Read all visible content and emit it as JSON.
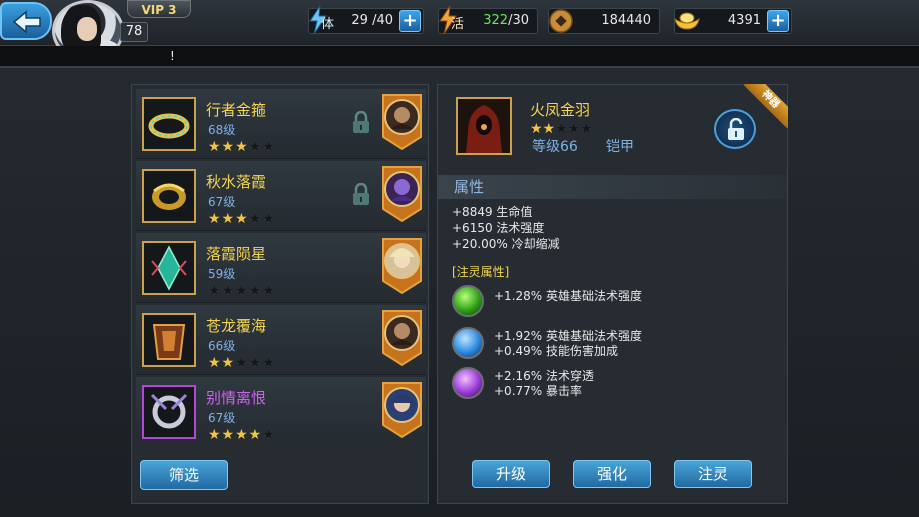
{
  "header": {
    "vip_label": "VIP 3",
    "player_level": "78",
    "stamina_label": "体",
    "stamina_value": "29",
    "stamina_max": "/40",
    "vitality_label": "活",
    "vitality_value": "322",
    "vitality_max": "/30",
    "coins": "184440",
    "ingots": "4391"
  },
  "notice": "!",
  "equipment_list": [
    {
      "name": "行者金箍",
      "level": "68级",
      "stars": 3,
      "locked": true,
      "rarity": "gold"
    },
    {
      "name": "秋水落霞",
      "level": "67级",
      "stars": 3,
      "locked": true,
      "rarity": "gold"
    },
    {
      "name": "落霞陨星",
      "level": "59级",
      "stars": 0,
      "locked": false,
      "rarity": "gold"
    },
    {
      "name": "苍龙覆海",
      "level": "66级",
      "stars": 2,
      "locked": false,
      "rarity": "gold"
    },
    {
      "name": "别情离恨",
      "level": "67级",
      "stars": 4,
      "locked": false,
      "rarity": "purple"
    }
  ],
  "filter_button": "筛选",
  "detail": {
    "name": "火凤金羽",
    "stars": 2,
    "level": "等级66",
    "type": "铠甲",
    "tag": "神器",
    "section_title": "属性",
    "stats": [
      "+8849 生命值",
      "+6150 法术强度",
      "+20.00% 冷却缩减"
    ],
    "infusion_title": "[注灵属性]",
    "infusions": [
      {
        "gem": "green",
        "lines": [
          "+1.28% 英雄基础法术强度"
        ]
      },
      {
        "gem": "blue",
        "lines": [
          "+1.92% 英雄基础法术强度",
          "+0.49% 技能伤害加成"
        ]
      },
      {
        "gem": "purple",
        "lines": [
          "+2.16% 法术穿透",
          "+0.77% 暴击率"
        ]
      }
    ]
  },
  "actions": {
    "upgrade": "升级",
    "enhance": "强化",
    "infuse": "注灵"
  },
  "colors": {
    "gold_name": "#f4d54e",
    "purple_name": "#cf62f0",
    "level_blue": "#7fb2e5",
    "star_on": "#f5c542",
    "button_blue": "#1f6aa3"
  }
}
